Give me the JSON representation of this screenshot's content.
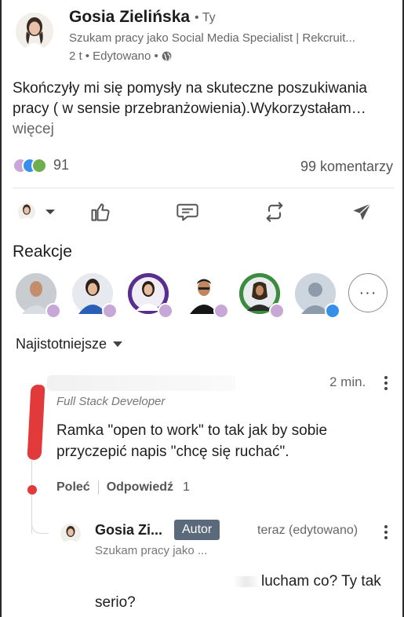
{
  "post": {
    "author_name": "Gosia Zielińska",
    "author_degree": "• Ty",
    "author_headline": "Szukam pracy jako Social Media Specialist | Rekcruit...",
    "time": "2 t",
    "edited": "• Edytowano •",
    "text": "Skończyły mi się pomysły na skuteczne poszukiwania pracy ( w sensie przebranżowienia).Wykorzystałam…",
    "more_label": " więcej",
    "reaction_count": "91",
    "comments_count": "99 komentarzy"
  },
  "actions": [
    {
      "name": "reaction-picker",
      "icon": "avatar-caret"
    },
    {
      "name": "like",
      "icon": "thumbs-up-icon"
    },
    {
      "name": "comment",
      "icon": "comment-icon"
    },
    {
      "name": "repost",
      "icon": "repost-icon"
    },
    {
      "name": "send",
      "icon": "send-icon"
    }
  ],
  "reactions_section": {
    "title": "Reakcje",
    "more_label": "···"
  },
  "sort": {
    "label": "Najistotniejsze"
  },
  "comment": {
    "time": "2 min.",
    "headline": "Full Stack Developer",
    "text": "Ramka \"open to work\" to tak jak by sobie przyczepić napis \"chcę się ruchać\".",
    "like_label": "Poleć",
    "reply_label": "Odpowiedź",
    "reply_count": "1"
  },
  "reply": {
    "author_name": "Gosia Zi...",
    "author_badge": "Autor",
    "time": "teraz (edytowano)",
    "headline": "Szukam pracy jako ...",
    "text": "lucham co? Ty tak serio?"
  },
  "colors": {
    "accent_red": "#e23a3a",
    "badge_bg": "#5b6a7b",
    "like_blue": "#0a66c2"
  }
}
